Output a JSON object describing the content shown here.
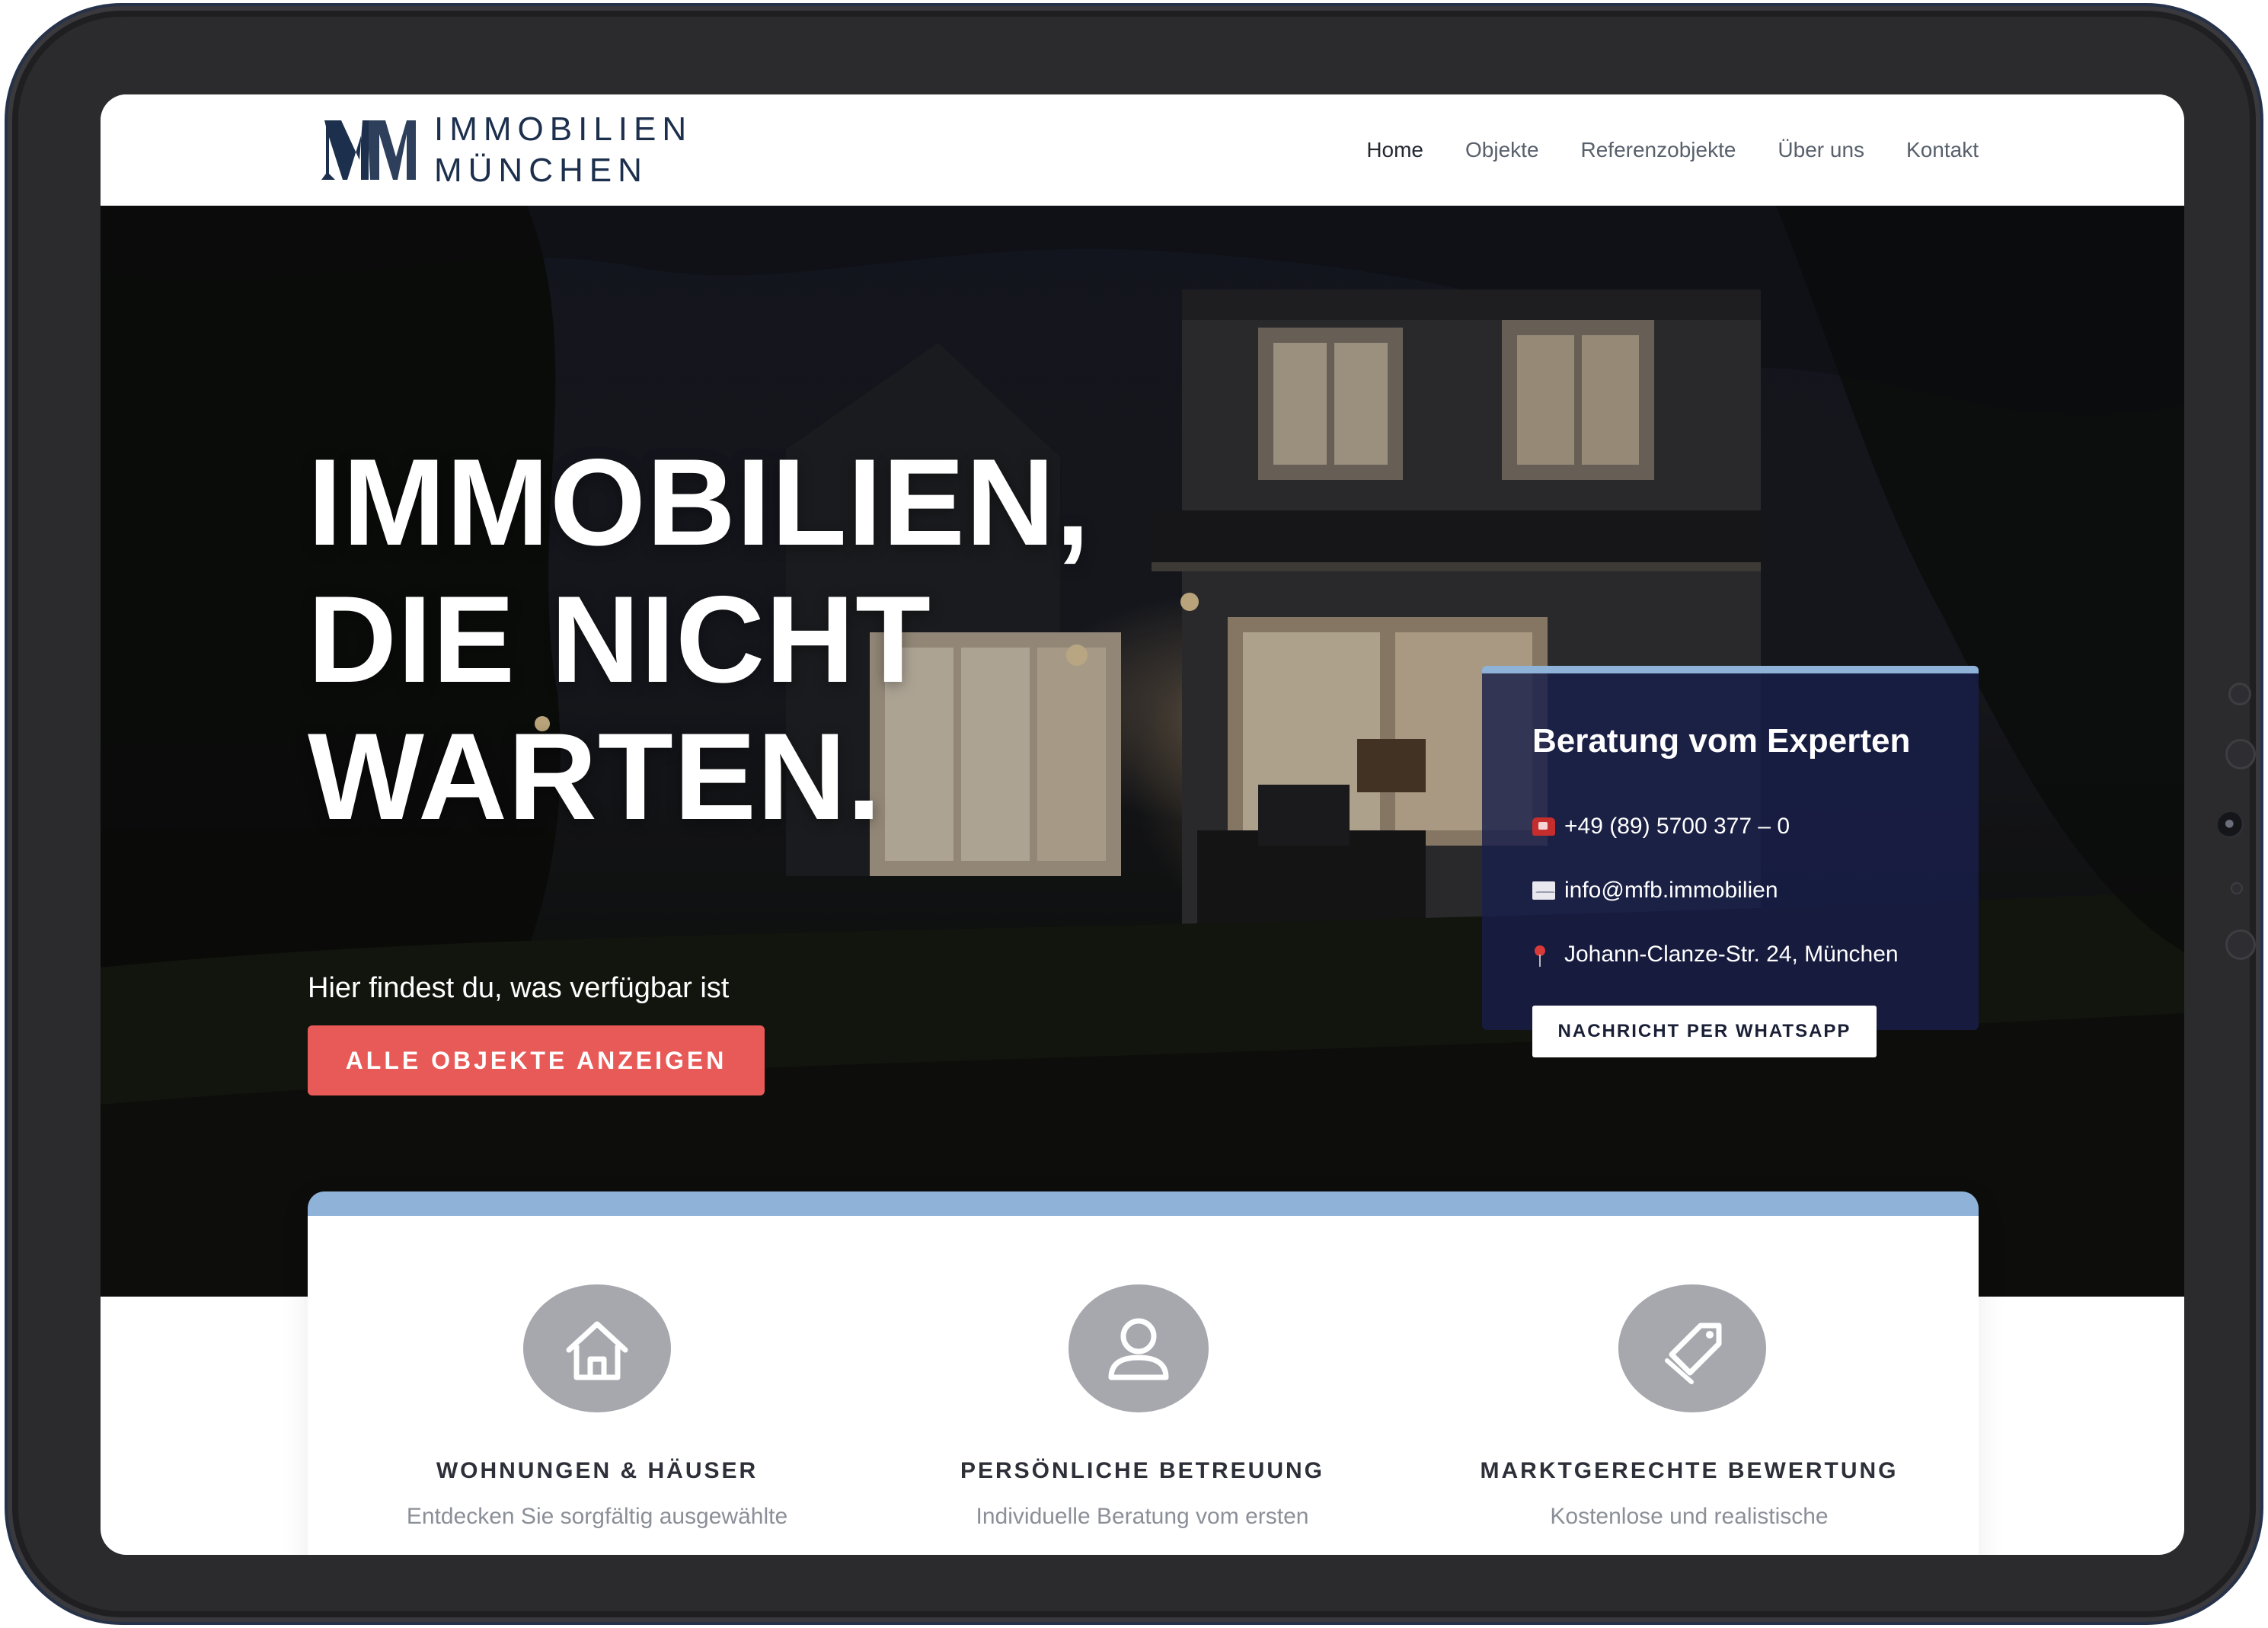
{
  "brand": {
    "logo_line1": "IMMOBILIEN",
    "logo_line2": "MÜNCHEN",
    "logo_monogram": "MM",
    "color_navy": "#1c2f4d"
  },
  "nav": {
    "items": [
      {
        "label": "Home",
        "active": true
      },
      {
        "label": "Objekte",
        "active": false
      },
      {
        "label": "Referenzobjekte",
        "active": false
      },
      {
        "label": "Über uns",
        "active": false
      },
      {
        "label": "Kontakt",
        "active": false
      }
    ]
  },
  "hero": {
    "title_lines": [
      "IMMOBILIEN,",
      "DIE NICHT",
      "WARTEN."
    ],
    "subtitle": "Hier findest du, was verfügbar ist",
    "cta_label": "ALLE OBJEKTE ANZEIGEN",
    "cta_color": "#e85a57"
  },
  "consult": {
    "title": "Beratung vom Experten",
    "phone": "+49 (89) 5700 377 – 0",
    "email": "info@mfb.immobilien",
    "address": "Johann-Clanze-Str. 24, München",
    "whatsapp_label": "NACHRICHT PER WHATSAPP",
    "icons": [
      "phone-icon",
      "envelope-icon",
      "pin-icon"
    ],
    "accent_color": "#8fb2d9"
  },
  "features": [
    {
      "icon": "house-icon",
      "title": "WOHNUNGEN & HÄUSER",
      "text": "Entdecken Sie sorgfältig ausgewählte"
    },
    {
      "icon": "person-icon",
      "title": "PERSÖNLICHE BETREUUNG",
      "text": "Individuelle Beratung vom ersten"
    },
    {
      "icon": "tag-icon",
      "title": "MARKTGERECHTE BEWERTUNG",
      "text": "Kostenlose und realistische"
    }
  ]
}
